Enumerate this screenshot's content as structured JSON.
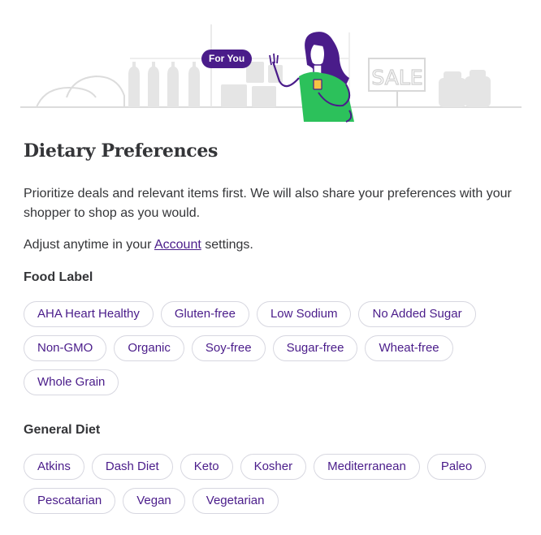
{
  "hero": {
    "badge": "For You",
    "sign_text": "SALE"
  },
  "title": "Dietary Preferences",
  "description": "Prioritize deals and relevant items first. We will also share your preferences with your shopper to shop as you would.",
  "adjust": {
    "before": "Adjust anytime in your ",
    "link": "Account",
    "after": " settings."
  },
  "food_label": {
    "title": "Food Label",
    "options": [
      "AHA Heart Healthy",
      "Gluten-free",
      "Low Sodium",
      "No Added Sugar",
      "Non-GMO",
      "Organic",
      "Soy-free",
      "Sugar-free",
      "Wheat-free",
      "Whole Grain"
    ]
  },
  "general_diet": {
    "title": "General Diet",
    "options": [
      "Atkins",
      "Dash Diet",
      "Keto",
      "Kosher",
      "Mediterranean",
      "Paleo",
      "Pescatarian",
      "Vegan",
      "Vegetarian"
    ]
  },
  "colors": {
    "brand_purple": "#4a1c8a",
    "shirt_green": "#2cc15b",
    "chip_border": "#d7d7e0"
  }
}
